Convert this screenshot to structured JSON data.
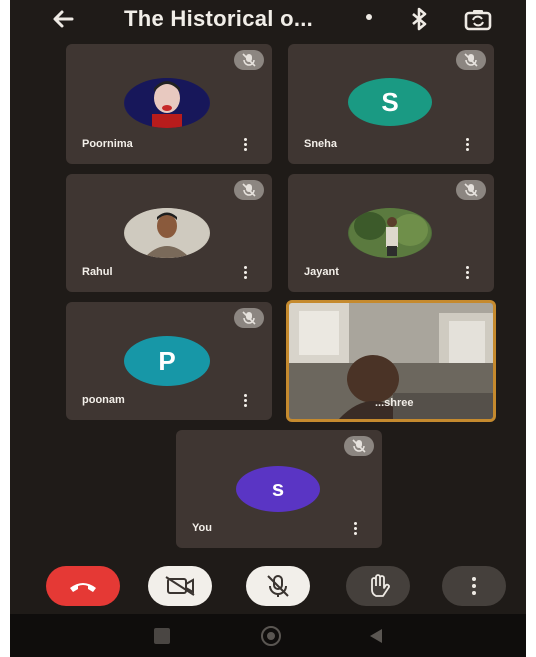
{
  "header": {
    "title": "The Historical o...",
    "back_icon": "arrow-left-icon",
    "bluetooth_icon": "bluetooth-icon",
    "switch_camera_icon": "switch-camera-icon"
  },
  "participants": [
    {
      "name": "Poornima",
      "avatar": "photo",
      "muted": true
    },
    {
      "name": "Sneha",
      "avatar_letter": "S",
      "avatar_color": "#1a9a83",
      "muted": true
    },
    {
      "name": "Rahul",
      "avatar": "photo",
      "muted": true
    },
    {
      "name": "Jayant",
      "avatar": "photo",
      "muted": true
    },
    {
      "name": "poonam",
      "avatar_letter": "P",
      "avatar_color": "#1797a7",
      "muted": true
    },
    {
      "name": "...shree",
      "avatar": "video",
      "speaking": true
    },
    {
      "name": "You",
      "avatar_letter": "s",
      "avatar_color": "#5a35c4",
      "muted": true
    }
  ],
  "controls": {
    "end_call_color": "#e53935",
    "buttons": [
      "end-call",
      "camera-off",
      "mic-off",
      "raise-hand",
      "more-options"
    ]
  },
  "nav": [
    "recent-apps",
    "home",
    "back"
  ]
}
